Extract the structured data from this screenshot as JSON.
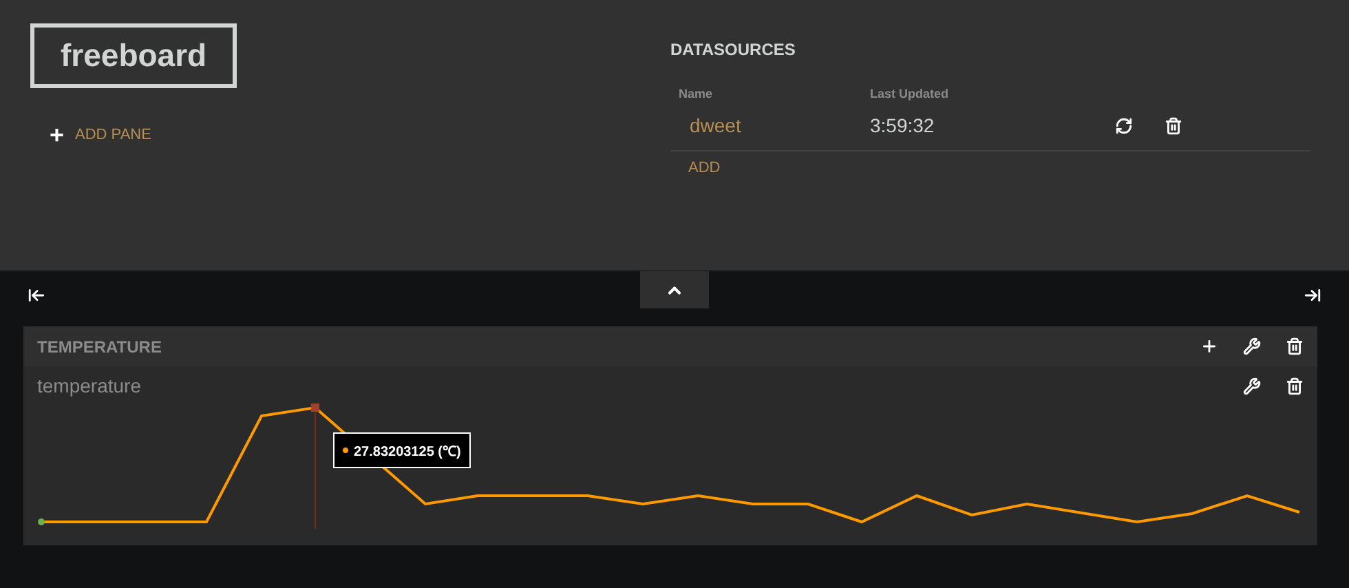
{
  "logo": "freeboard",
  "add_pane": {
    "icon": "+",
    "label": "ADD PANE"
  },
  "datasources": {
    "title": "DATASOURCES",
    "columns": [
      "Name",
      "Last Updated"
    ],
    "rows": [
      {
        "name": "dweet",
        "last_updated": "3:59:32"
      }
    ],
    "add": "ADD"
  },
  "panes": [
    {
      "title": "TEMPERATURE",
      "widgets": [
        {
          "kind": "sparkline",
          "title": "temperature",
          "tooltip": "27.83203125 (℃)"
        }
      ]
    }
  ]
}
